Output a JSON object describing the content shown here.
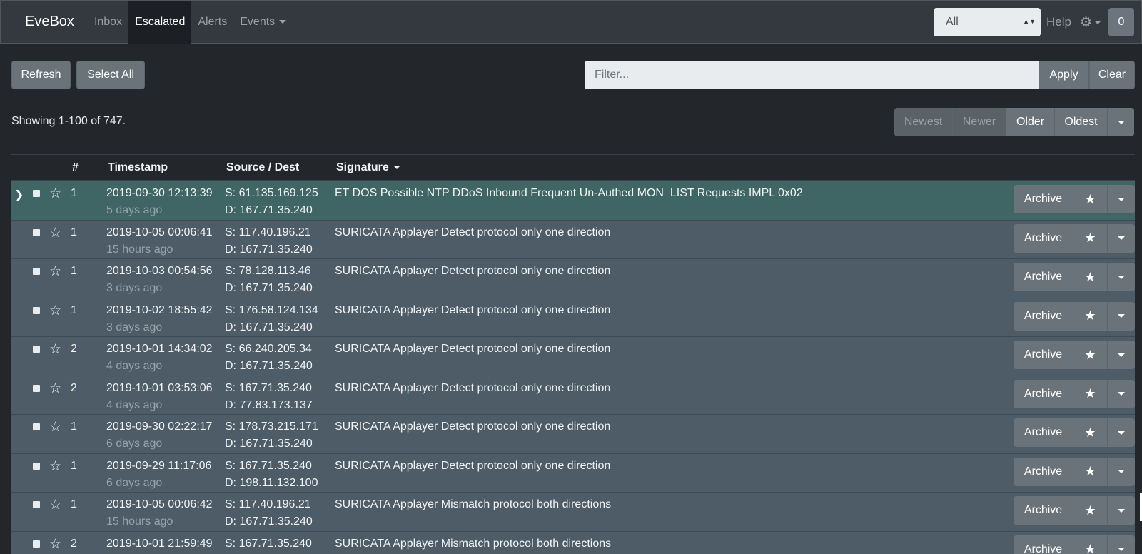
{
  "nav": {
    "brand": "EveBox",
    "items": [
      {
        "label": "Inbox",
        "active": false
      },
      {
        "label": "Escalated",
        "active": true
      },
      {
        "label": "Alerts",
        "active": false
      },
      {
        "label": "Events",
        "active": false
      }
    ],
    "select_value": "All",
    "help_label": "Help",
    "badge_count": "0"
  },
  "toolbar": {
    "refresh_label": "Refresh",
    "select_all_label": "Select All",
    "filter_placeholder": "Filter...",
    "apply_label": "Apply",
    "clear_label": "Clear"
  },
  "summary": "Showing 1-100 of 747.",
  "pager": {
    "newest": "Newest",
    "newer": "Newer",
    "older": "Older",
    "oldest": "Oldest"
  },
  "table": {
    "headers": {
      "count": "#",
      "timestamp": "Timestamp",
      "source_dest": "Source / Dest",
      "signature": "Signature"
    },
    "archive_label": "Archive",
    "rows": [
      {
        "count": "1",
        "timestamp": "2019-09-30 12:13:39",
        "ago": "5 days ago",
        "src": "S: 61.135.169.125",
        "dst": "D: 167.71.35.240",
        "signature": "ET DOS Possible NTP DDoS Inbound Frequent Un-Authed MON_LIST Requests IMPL 0x02",
        "selected": true
      },
      {
        "count": "1",
        "timestamp": "2019-10-05 00:06:41",
        "ago": "15 hours ago",
        "src": "S: 117.40.196.21",
        "dst": "D: 167.71.35.240",
        "signature": "SURICATA Applayer Detect protocol only one direction"
      },
      {
        "count": "1",
        "timestamp": "2019-10-03 00:54:56",
        "ago": "3 days ago",
        "src": "S: 78.128.113.46",
        "dst": "D: 167.71.35.240",
        "signature": "SURICATA Applayer Detect protocol only one direction"
      },
      {
        "count": "1",
        "timestamp": "2019-10-02 18:55:42",
        "ago": "3 days ago",
        "src": "S: 176.58.124.134",
        "dst": "D: 167.71.35.240",
        "signature": "SURICATA Applayer Detect protocol only one direction"
      },
      {
        "count": "2",
        "timestamp": "2019-10-01 14:34:02",
        "ago": "4 days ago",
        "src": "S: 66.240.205.34",
        "dst": "D: 167.71.35.240",
        "signature": "SURICATA Applayer Detect protocol only one direction"
      },
      {
        "count": "2",
        "timestamp": "2019-10-01 03:53:06",
        "ago": "4 days ago",
        "src": "S: 167.71.35.240",
        "dst": "D: 77.83.173.137",
        "signature": "SURICATA Applayer Detect protocol only one direction"
      },
      {
        "count": "1",
        "timestamp": "2019-09-30 02:22:17",
        "ago": "6 days ago",
        "src": "S: 178.73.215.171",
        "dst": "D: 167.71.35.240",
        "signature": "SURICATA Applayer Detect protocol only one direction"
      },
      {
        "count": "1",
        "timestamp": "2019-09-29 11:17:06",
        "ago": "6 days ago",
        "src": "S: 167.71.35.240",
        "dst": "D: 198.11.132.100",
        "signature": "SURICATA Applayer Detect protocol only one direction"
      },
      {
        "count": "1",
        "timestamp": "2019-10-05 00:06:42",
        "ago": "15 hours ago",
        "src": "S: 117.40.196.21",
        "dst": "D: 167.71.35.240",
        "signature": "SURICATA Applayer Mismatch protocol both directions"
      },
      {
        "count": "2",
        "timestamp": "2019-10-01 21:59:49",
        "ago": "",
        "src": "S: 167.71.35.240",
        "dst": "",
        "signature": "SURICATA Applayer Mismatch protocol both directions"
      }
    ]
  }
}
